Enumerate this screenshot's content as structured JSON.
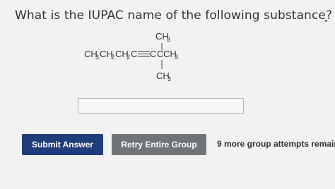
{
  "question": {
    "text": "What is the IUPAC name of the following substance?"
  },
  "structure": {
    "main_chain": [
      "CH",
      "3",
      "CH",
      "2",
      "CH",
      "2",
      "C",
      "C",
      "C",
      "CH",
      "3"
    ],
    "top_substituent": [
      "CH",
      "3"
    ],
    "bottom_substituent": [
      "CH",
      "3"
    ]
  },
  "answer": {
    "value": ""
  },
  "buttons": {
    "submit_label": "Submit Answer",
    "retry_label": "Retry Entire Group"
  },
  "status": {
    "attempts_text": "9 more group attempts remaini"
  },
  "colors": {
    "submit_bg": "#1f3d7a",
    "retry_bg": "#6f7478",
    "page_bg": "#f2f2f2"
  }
}
